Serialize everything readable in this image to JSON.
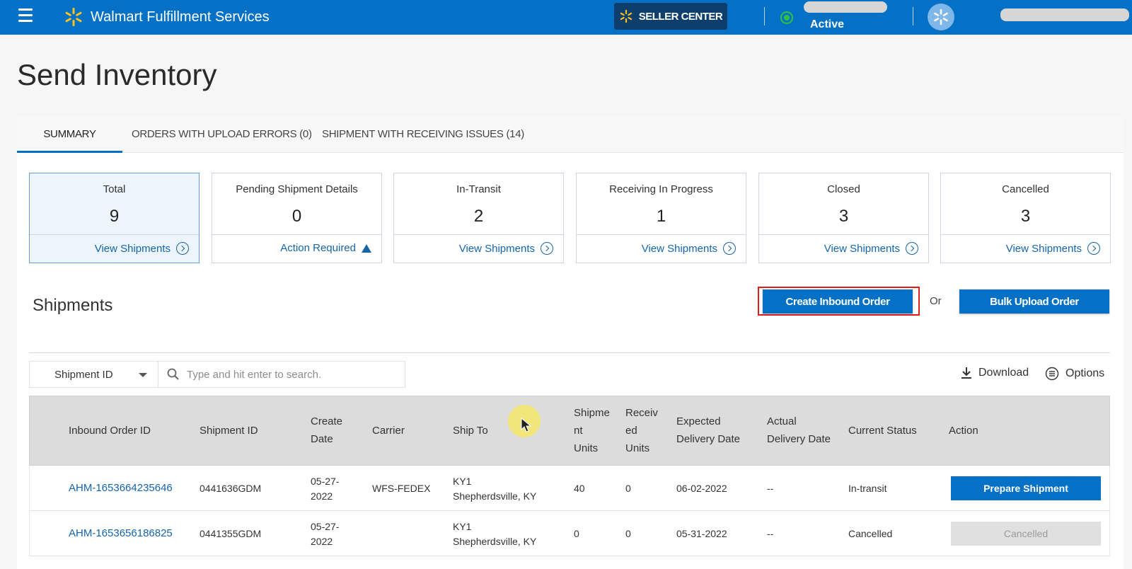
{
  "header": {
    "brand": "Walmart Fulfillment Services",
    "seller_center": "SELLER CENTER",
    "status": "Active",
    "colors": {
      "bar": "#0471c6",
      "seller_btn": "#0d3f6d",
      "status": "#2ec240"
    },
    "icons": [
      "menu-icon",
      "walmart-spark-icon",
      "status-indicator-icon",
      "account-avatar-icon"
    ]
  },
  "page": {
    "title": "Send Inventory"
  },
  "tabs": [
    {
      "label": "SUMMARY"
    },
    {
      "label": "ORDERS WITH UPLOAD ERRORS (0)"
    },
    {
      "label": "SHIPMENT WITH RECEIVING ISSUES (14)"
    }
  ],
  "cards": [
    {
      "title": "Total",
      "count": "9",
      "link": "View Shipments"
    },
    {
      "title": "Pending Shipment Details",
      "count": "0",
      "link": "Action Required"
    },
    {
      "title": "In-Transit",
      "count": "2",
      "link": "View Shipments"
    },
    {
      "title": "Receiving In Progress",
      "count": "1",
      "link": "View Shipments"
    },
    {
      "title": "Closed",
      "count": "3",
      "link": "View Shipments"
    },
    {
      "title": "Cancelled",
      "count": "3",
      "link": "View Shipments"
    }
  ],
  "shipments": {
    "heading": "Shipments",
    "create_btn": "Create Inbound Order",
    "or": "Or",
    "bulk_btn": "Bulk Upload Order",
    "filter_value": "Shipment ID",
    "search_placeholder": "Type and hit enter to search.",
    "download": "Download",
    "options": "Options"
  },
  "table": {
    "headers": {
      "inbound_order_id": "Inbound Order ID",
      "shipment_id": "Shipment ID",
      "create_date": [
        "Create",
        "Date"
      ],
      "carrier": "Carrier",
      "ship_to": "Ship To",
      "shipment_units": [
        "Shipme",
        "nt",
        "Units"
      ],
      "received_units": [
        "Receiv",
        "ed",
        "Units"
      ],
      "expected_delivery": [
        "Expected",
        "Delivery Date"
      ],
      "actual_delivery": [
        "Actual",
        "Delivery Date"
      ],
      "current_status": "Current Status",
      "action": "Action"
    },
    "rows": [
      {
        "inbound_order_id": "AHM-1653664235646",
        "shipment_id": "0441636GDM",
        "create_date": [
          "05-27-",
          "2022"
        ],
        "carrier": "WFS-FEDEX",
        "ship_to": [
          "KY1",
          "Shepherdsville, KY"
        ],
        "shipment_units": "40",
        "received_units": "0",
        "expected_delivery": "06-02-2022",
        "actual_delivery": "--",
        "status": "In-transit",
        "action": "Prepare Shipment"
      },
      {
        "inbound_order_id": "AHM-1653656186825",
        "shipment_id": "0441355GDM",
        "create_date": [
          "05-27-",
          "2022"
        ],
        "carrier": "",
        "ship_to": [
          "KY1",
          "Shepherdsville, KY"
        ],
        "shipment_units": "0",
        "received_units": "0",
        "expected_delivery": "05-31-2022",
        "actual_delivery": "--",
        "status": "Cancelled",
        "action": "Cancelled"
      }
    ]
  }
}
